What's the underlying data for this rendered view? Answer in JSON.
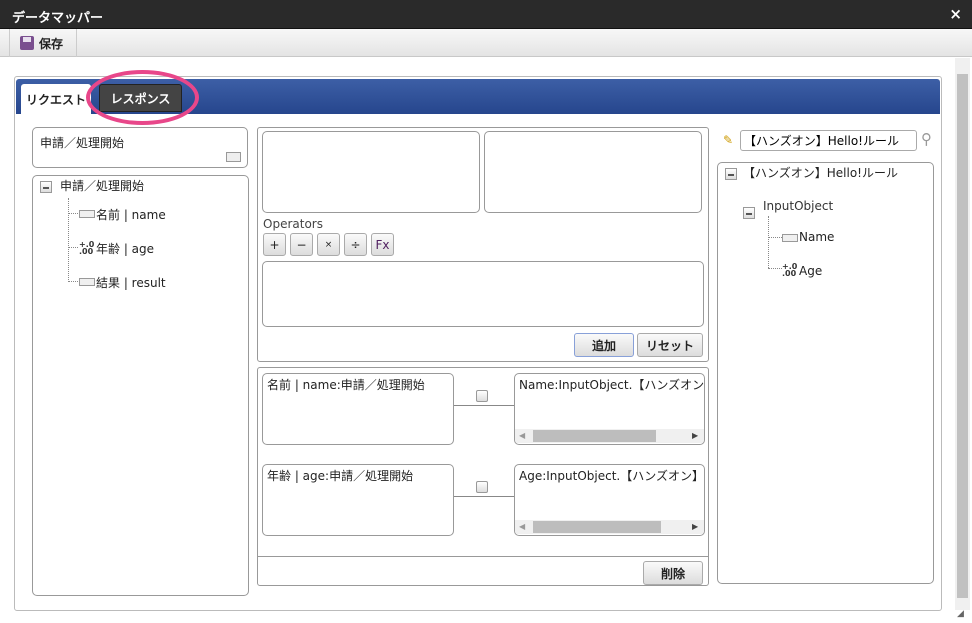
{
  "window": {
    "title": "データマッパー",
    "close_icon": "×"
  },
  "toolbar": {
    "save_label": "保存"
  },
  "tabs": [
    {
      "label": "リクエスト",
      "active": true
    },
    {
      "label": "レスポンス",
      "active": false
    }
  ],
  "left": {
    "selected": "申請／処理開始",
    "tree": {
      "root": "申請／処理開始",
      "items": [
        {
          "label": "名前 | name",
          "type": "string"
        },
        {
          "label": "年齢 | age",
          "type": "number"
        },
        {
          "label": "結果 | result",
          "type": "string"
        }
      ]
    }
  },
  "middle": {
    "operators_label": "Operators",
    "operators": [
      "+",
      "−",
      "×",
      "÷",
      "Fx"
    ],
    "add_label": "追加",
    "reset_label": "リセット",
    "delete_label": "削除",
    "mappings": [
      {
        "source": "名前 | name:申請／処理開始",
        "target": "Name:InputObject.【ハンズオン】Hello!ルール"
      },
      {
        "source": "年齢 | age:申請／処理開始",
        "target": "Age:InputObject.【ハンズオン】Hello!ルール"
      }
    ]
  },
  "right": {
    "search_value": "【ハンズオン】Hello!ルール",
    "tree": {
      "root": "【ハンズオン】Hello!ルール",
      "object": "InputObject",
      "items": [
        {
          "label": "Name",
          "type": "string"
        },
        {
          "label": "Age",
          "type": "number"
        }
      ]
    }
  },
  "colors": {
    "tabbar": "#2f4f96",
    "highlight": "#e8478a"
  }
}
